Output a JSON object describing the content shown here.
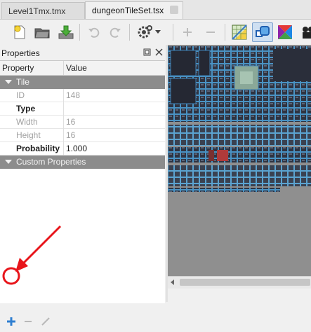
{
  "tabs": [
    {
      "label": "Level1Tmx.tmx",
      "active": false
    },
    {
      "label": "dungeonTileSet.tsx",
      "active": true
    }
  ],
  "toolbar": {
    "icons": [
      "new-file-icon",
      "open-file-icon",
      "save-icon",
      "undo-icon",
      "redo-icon",
      "gear-icon",
      "dropdown-arrow-icon",
      "add-icon",
      "remove-icon",
      "tileset-image-icon",
      "terrain-icon",
      "color-wheel-icon",
      "film-icon"
    ]
  },
  "properties_panel": {
    "title": "Properties",
    "columns": {
      "property": "Property",
      "value": "Value"
    },
    "groups": [
      {
        "label": "Tile",
        "rows": [
          {
            "key": "ID",
            "value": "148",
            "disabled": true,
            "bold": false
          },
          {
            "key": "Type",
            "value": "",
            "disabled": false,
            "bold": true
          },
          {
            "key": "Width",
            "value": "16",
            "disabled": true,
            "bold": false
          },
          {
            "key": "Height",
            "value": "16",
            "disabled": true,
            "bold": false
          },
          {
            "key": "Probability",
            "value": "1.000",
            "disabled": false,
            "bold": true
          }
        ]
      },
      {
        "label": "Custom Properties",
        "rows": []
      }
    ]
  },
  "bottom_buttons": [
    "add-property-icon",
    "remove-property-icon",
    "rename-property-icon"
  ],
  "colors": {
    "accent": "#3a7bd5",
    "annotation": "#e8151b",
    "group_row": "#8c8c8c",
    "tile_bg": "#2f3340",
    "tile_frame": "#4a93c4"
  }
}
